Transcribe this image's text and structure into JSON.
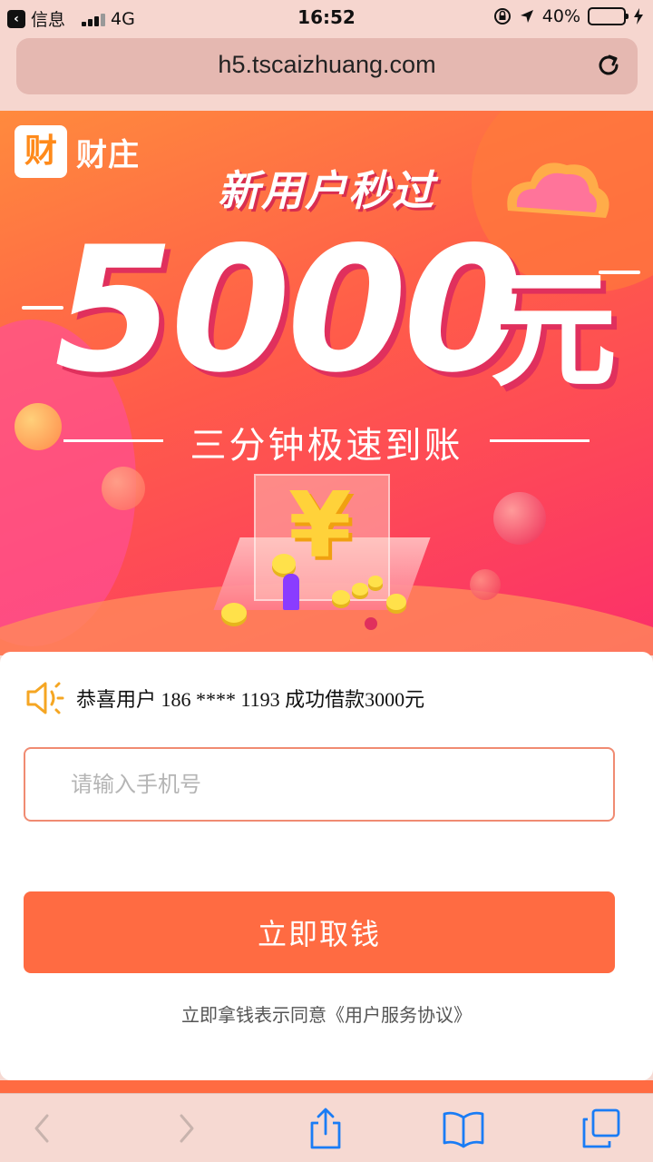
{
  "status_bar": {
    "back_app": "信息",
    "network": "4G",
    "time": "16:52",
    "battery_percent": "40%",
    "battery_level": 0.4
  },
  "browser": {
    "url": "h5.tscaizhuang.com"
  },
  "banner": {
    "logo_glyph": "财",
    "logo_name": "财庄",
    "headline": "新用户秒过",
    "amount": "5000",
    "amount_unit": "元",
    "subline": "三分钟极速到账",
    "center_symbol": "¥"
  },
  "card": {
    "notice": "恭喜用户 186 **** 1193 成功借款3000元",
    "phone_placeholder": "请输入手机号",
    "phone_value": "",
    "submit_label": "立即取钱",
    "agreement_prefix": "立即拿钱表示同意",
    "agreement_link": "《用户服务协议》"
  },
  "colors": {
    "accent": "#ff6b42",
    "input_border": "#f08b72",
    "logo_orange": "#ff8a1a",
    "battery_green": "#4cd964"
  },
  "icons": {
    "back": "chevron-left-icon",
    "reload": "reload-icon",
    "notice": "speaker-icon",
    "share": "share-icon",
    "bookmarks": "book-icon",
    "tabs": "tabs-icon"
  }
}
